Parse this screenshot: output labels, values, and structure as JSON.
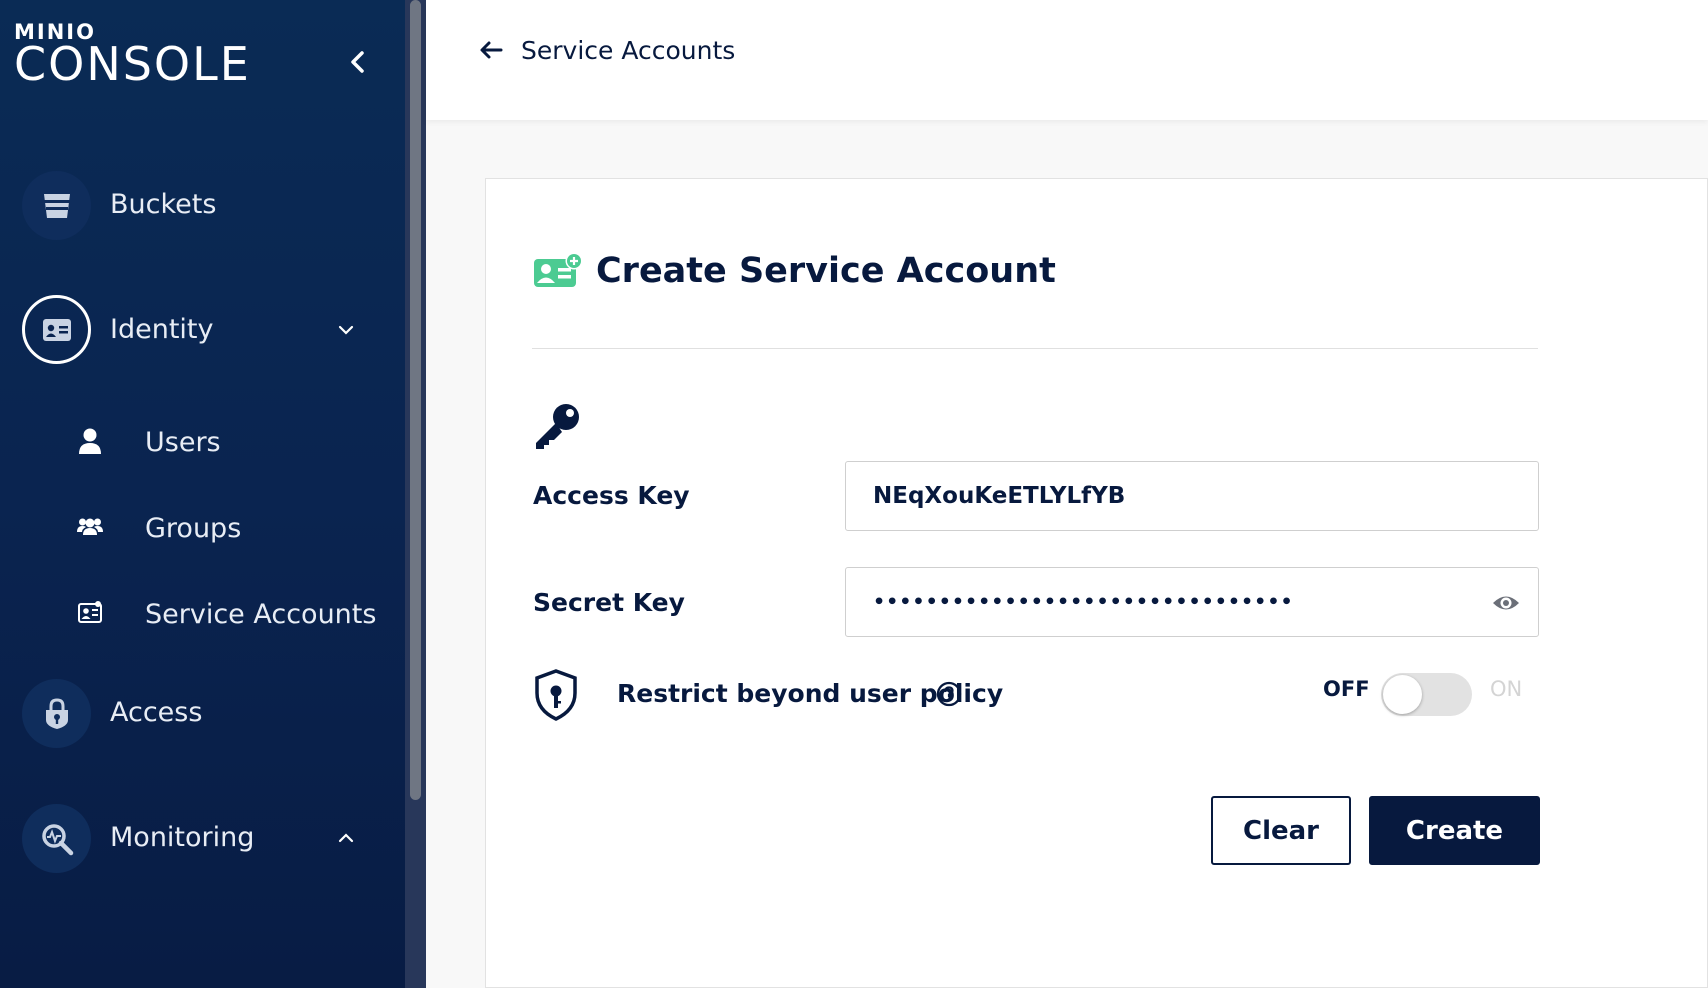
{
  "sidebar": {
    "logo_small": "MINIO",
    "logo_large": "CONSOLE",
    "items": [
      {
        "label": "Buckets"
      },
      {
        "label": "Identity"
      },
      {
        "label": "Access"
      },
      {
        "label": "Monitoring"
      }
    ],
    "sub_items": [
      {
        "label": "Users"
      },
      {
        "label": "Groups"
      },
      {
        "label": "Service Accounts"
      }
    ]
  },
  "header": {
    "back_label": "Service Accounts"
  },
  "form": {
    "title": "Create Service Account",
    "access_key_label": "Access Key",
    "access_key_value": "NEqXouKeETLYLfYB",
    "secret_key_label": "Secret Key",
    "secret_key_masked": "••••••••••••••••••••••••••••••••",
    "restrict_label": "Restrict beyond user policy",
    "toggle_off_label": "OFF",
    "toggle_on_label": "ON",
    "toggle_state": "off",
    "clear_label": "Clear",
    "create_label": "Create"
  },
  "colors": {
    "sidebar_bg": "#0a2b55",
    "primary": "#07193e",
    "accent_green": "#4ccb92"
  }
}
